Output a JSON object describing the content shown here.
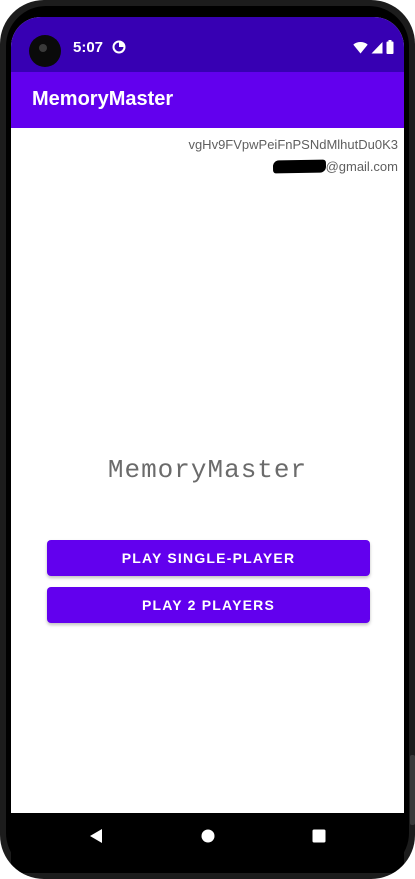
{
  "status_bar": {
    "time": "5:07",
    "icons": [
      "data-saver-icon",
      "wifi-icon",
      "signal-icon",
      "battery-icon"
    ],
    "color": "#3700b3"
  },
  "app_bar": {
    "title": "MemoryMaster",
    "color": "#6200ee"
  },
  "user": {
    "id": "vgHv9FVpwPeiFnPSNdMlhutDu0K3",
    "email_domain": "@gmail.com"
  },
  "main": {
    "game_title": "MemoryMaster",
    "buttons": {
      "single_player": "PLAY SINGLE-PLAYER",
      "two_players": "PLAY 2 PLAYERS"
    }
  },
  "nav_bar": {
    "icons": [
      "back-icon",
      "home-icon",
      "recents-icon"
    ]
  }
}
